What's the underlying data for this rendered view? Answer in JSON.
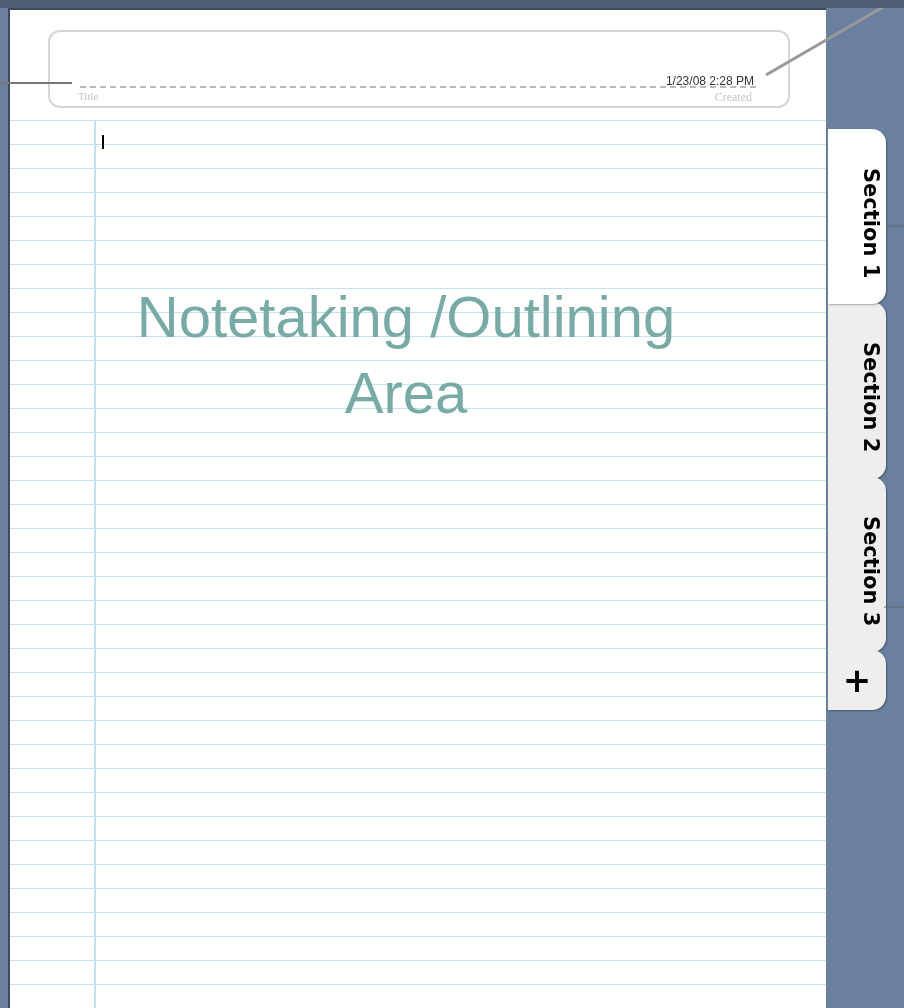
{
  "header": {
    "title_placeholder": "Title",
    "created_date": "1/23/08 2:28 PM",
    "created_label": "Created"
  },
  "notes_area": {
    "label": "Notetaking /Outlining Area"
  },
  "tabs": [
    {
      "label": "Section 1",
      "selected": true
    },
    {
      "label": "Section 2",
      "selected": false
    },
    {
      "label": "Section 3",
      "selected": false
    }
  ],
  "add_tab": {
    "label": "+"
  }
}
